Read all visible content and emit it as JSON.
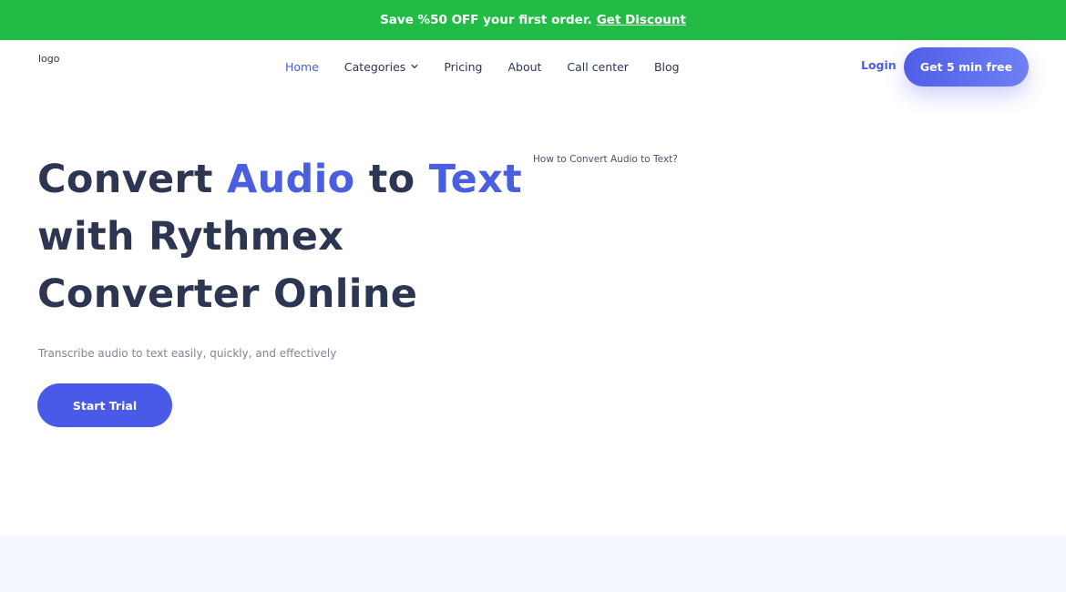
{
  "promo": {
    "text": "Save %50 OFF your first order.",
    "link_label": "Get Discount"
  },
  "header": {
    "logo_text": "logo",
    "nav": [
      {
        "label": "Home",
        "active": true
      },
      {
        "label": "Categories",
        "has_dropdown": true
      },
      {
        "label": "Pricing"
      },
      {
        "label": "About"
      },
      {
        "label": "Call center"
      },
      {
        "label": "Blog"
      }
    ],
    "login_label": "Login",
    "cta_label": "Get 5 min free"
  },
  "hero": {
    "title_parts": [
      "Convert ",
      "Audio",
      " to ",
      "Text",
      " with Rythmex Converter Online"
    ],
    "subtitle": "Transcribe audio to text easily, quickly, and effectively",
    "button_label": "Start Trial",
    "video_caption": "How to Convert Audio to Text?"
  },
  "colors": {
    "promo_bg": "#22bb45",
    "accent": "#4a5fe0",
    "heading": "#2c3552",
    "section_bg": "#f5f8fe"
  }
}
